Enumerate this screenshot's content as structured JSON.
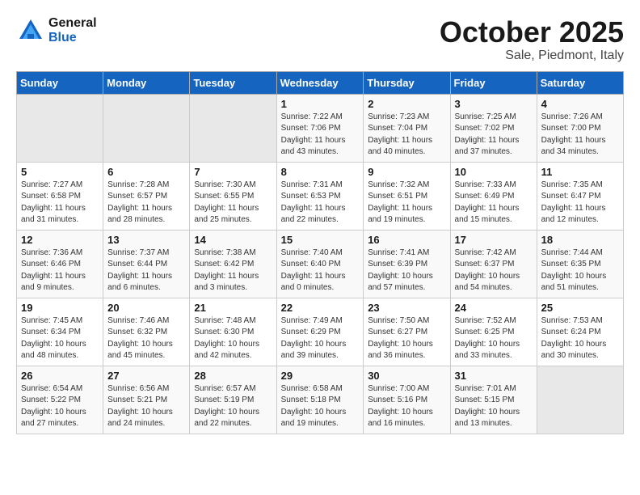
{
  "header": {
    "logo_line1": "General",
    "logo_line2": "Blue",
    "title": "October 2025",
    "subtitle": "Sale, Piedmont, Italy"
  },
  "weekdays": [
    "Sunday",
    "Monday",
    "Tuesday",
    "Wednesday",
    "Thursday",
    "Friday",
    "Saturday"
  ],
  "weeks": [
    [
      {
        "num": "",
        "info": ""
      },
      {
        "num": "",
        "info": ""
      },
      {
        "num": "",
        "info": ""
      },
      {
        "num": "1",
        "info": "Sunrise: 7:22 AM\nSunset: 7:06 PM\nDaylight: 11 hours and 43 minutes."
      },
      {
        "num": "2",
        "info": "Sunrise: 7:23 AM\nSunset: 7:04 PM\nDaylight: 11 hours and 40 minutes."
      },
      {
        "num": "3",
        "info": "Sunrise: 7:25 AM\nSunset: 7:02 PM\nDaylight: 11 hours and 37 minutes."
      },
      {
        "num": "4",
        "info": "Sunrise: 7:26 AM\nSunset: 7:00 PM\nDaylight: 11 hours and 34 minutes."
      }
    ],
    [
      {
        "num": "5",
        "info": "Sunrise: 7:27 AM\nSunset: 6:58 PM\nDaylight: 11 hours and 31 minutes."
      },
      {
        "num": "6",
        "info": "Sunrise: 7:28 AM\nSunset: 6:57 PM\nDaylight: 11 hours and 28 minutes."
      },
      {
        "num": "7",
        "info": "Sunrise: 7:30 AM\nSunset: 6:55 PM\nDaylight: 11 hours and 25 minutes."
      },
      {
        "num": "8",
        "info": "Sunrise: 7:31 AM\nSunset: 6:53 PM\nDaylight: 11 hours and 22 minutes."
      },
      {
        "num": "9",
        "info": "Sunrise: 7:32 AM\nSunset: 6:51 PM\nDaylight: 11 hours and 19 minutes."
      },
      {
        "num": "10",
        "info": "Sunrise: 7:33 AM\nSunset: 6:49 PM\nDaylight: 11 hours and 15 minutes."
      },
      {
        "num": "11",
        "info": "Sunrise: 7:35 AM\nSunset: 6:47 PM\nDaylight: 11 hours and 12 minutes."
      }
    ],
    [
      {
        "num": "12",
        "info": "Sunrise: 7:36 AM\nSunset: 6:46 PM\nDaylight: 11 hours and 9 minutes."
      },
      {
        "num": "13",
        "info": "Sunrise: 7:37 AM\nSunset: 6:44 PM\nDaylight: 11 hours and 6 minutes."
      },
      {
        "num": "14",
        "info": "Sunrise: 7:38 AM\nSunset: 6:42 PM\nDaylight: 11 hours and 3 minutes."
      },
      {
        "num": "15",
        "info": "Sunrise: 7:40 AM\nSunset: 6:40 PM\nDaylight: 11 hours and 0 minutes."
      },
      {
        "num": "16",
        "info": "Sunrise: 7:41 AM\nSunset: 6:39 PM\nDaylight: 10 hours and 57 minutes."
      },
      {
        "num": "17",
        "info": "Sunrise: 7:42 AM\nSunset: 6:37 PM\nDaylight: 10 hours and 54 minutes."
      },
      {
        "num": "18",
        "info": "Sunrise: 7:44 AM\nSunset: 6:35 PM\nDaylight: 10 hours and 51 minutes."
      }
    ],
    [
      {
        "num": "19",
        "info": "Sunrise: 7:45 AM\nSunset: 6:34 PM\nDaylight: 10 hours and 48 minutes."
      },
      {
        "num": "20",
        "info": "Sunrise: 7:46 AM\nSunset: 6:32 PM\nDaylight: 10 hours and 45 minutes."
      },
      {
        "num": "21",
        "info": "Sunrise: 7:48 AM\nSunset: 6:30 PM\nDaylight: 10 hours and 42 minutes."
      },
      {
        "num": "22",
        "info": "Sunrise: 7:49 AM\nSunset: 6:29 PM\nDaylight: 10 hours and 39 minutes."
      },
      {
        "num": "23",
        "info": "Sunrise: 7:50 AM\nSunset: 6:27 PM\nDaylight: 10 hours and 36 minutes."
      },
      {
        "num": "24",
        "info": "Sunrise: 7:52 AM\nSunset: 6:25 PM\nDaylight: 10 hours and 33 minutes."
      },
      {
        "num": "25",
        "info": "Sunrise: 7:53 AM\nSunset: 6:24 PM\nDaylight: 10 hours and 30 minutes."
      }
    ],
    [
      {
        "num": "26",
        "info": "Sunrise: 6:54 AM\nSunset: 5:22 PM\nDaylight: 10 hours and 27 minutes."
      },
      {
        "num": "27",
        "info": "Sunrise: 6:56 AM\nSunset: 5:21 PM\nDaylight: 10 hours and 24 minutes."
      },
      {
        "num": "28",
        "info": "Sunrise: 6:57 AM\nSunset: 5:19 PM\nDaylight: 10 hours and 22 minutes."
      },
      {
        "num": "29",
        "info": "Sunrise: 6:58 AM\nSunset: 5:18 PM\nDaylight: 10 hours and 19 minutes."
      },
      {
        "num": "30",
        "info": "Sunrise: 7:00 AM\nSunset: 5:16 PM\nDaylight: 10 hours and 16 minutes."
      },
      {
        "num": "31",
        "info": "Sunrise: 7:01 AM\nSunset: 5:15 PM\nDaylight: 10 hours and 13 minutes."
      },
      {
        "num": "",
        "info": ""
      }
    ]
  ]
}
